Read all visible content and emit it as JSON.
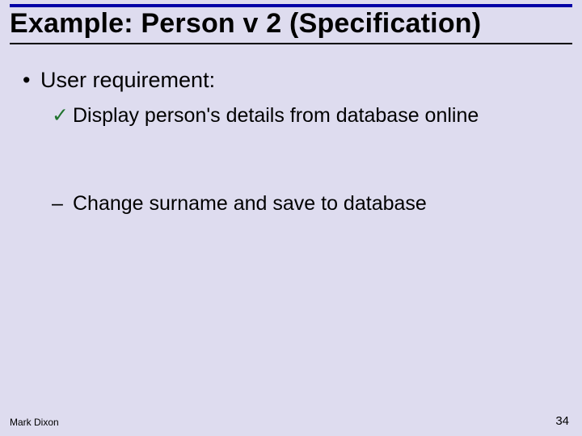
{
  "title": "Example: Person v 2 (Specification)",
  "body": {
    "lvl1": {
      "bullet": "•",
      "text": "User requirement:"
    },
    "check": {
      "bullet": "✓",
      "text": "Display person's details from database online"
    },
    "dash": {
      "bullet": "–",
      "text": "Change surname and save to database"
    }
  },
  "footer": {
    "author": "Mark Dixon",
    "page": "34"
  }
}
